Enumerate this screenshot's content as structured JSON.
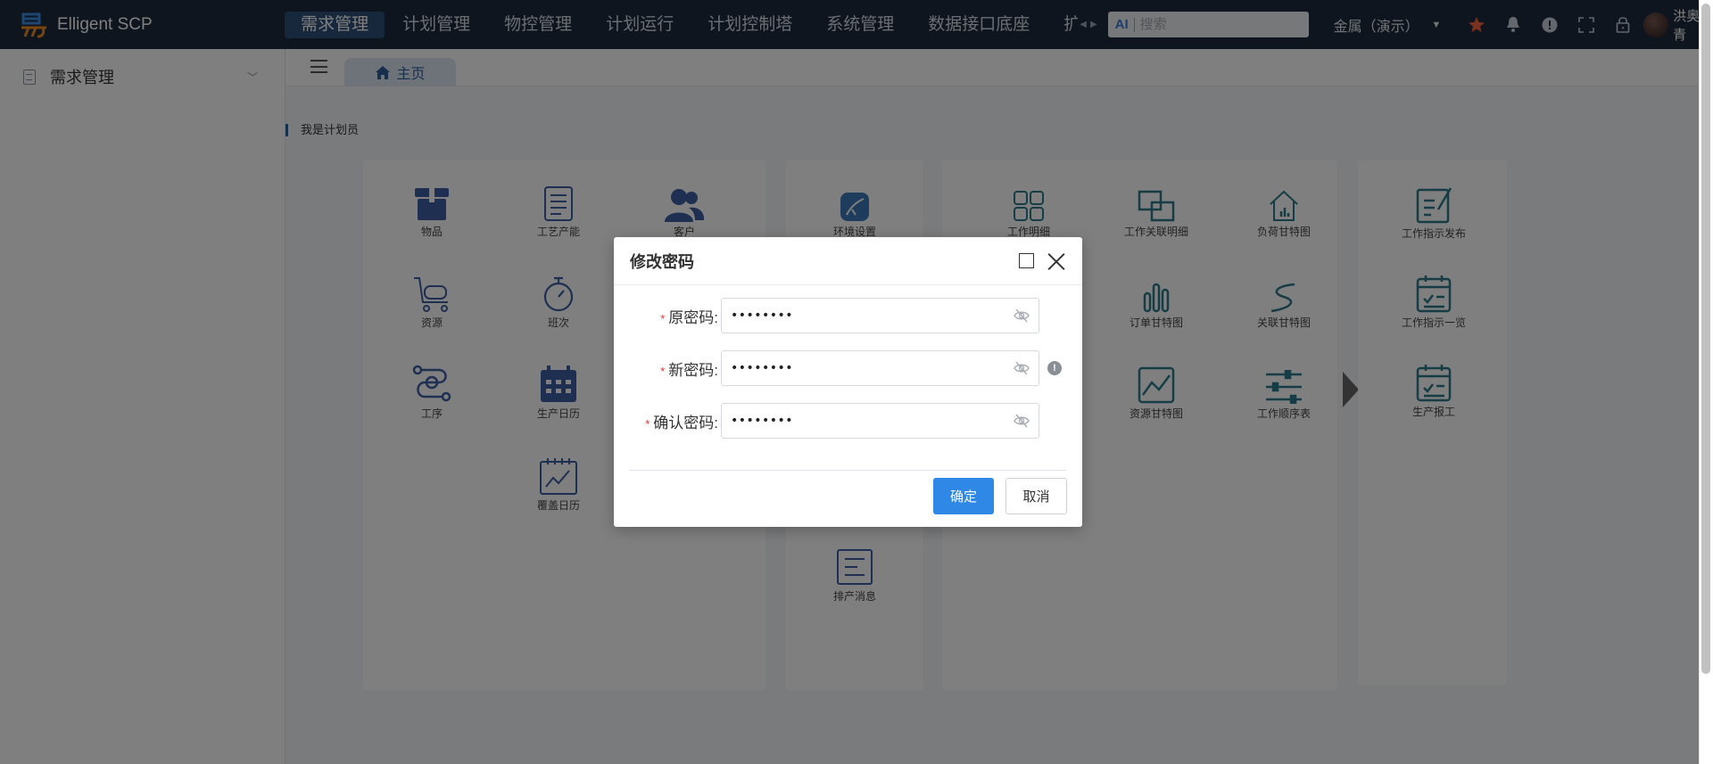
{
  "app": {
    "title": "Elligent SCP",
    "nav": [
      {
        "label": "需求管理",
        "active": true
      },
      {
        "label": "计划管理"
      },
      {
        "label": "物控管理"
      },
      {
        "label": "计划运行"
      },
      {
        "label": "计划控制塔"
      },
      {
        "label": "系统管理"
      },
      {
        "label": "数据接口底座"
      },
      {
        "label": "扩展"
      }
    ],
    "search": {
      "ai_label": "AI",
      "placeholder": "搜索"
    },
    "tenant": "金属（演示）",
    "user": "洪奥青",
    "icons": [
      "star-icon",
      "bell-icon",
      "alert-icon",
      "fullscreen-icon",
      "lock-icon"
    ]
  },
  "sidebar": {
    "items": [
      {
        "label": "需求管理"
      }
    ]
  },
  "tabs": [
    {
      "label": "主页"
    }
  ],
  "section_title": "我是计划员",
  "panels": {
    "panel1": [
      "物品",
      "工艺产能",
      "客户",
      "资源",
      "班次",
      "工序",
      "生产日历",
      "覆盖日历"
    ],
    "panel2": [
      "环境设置",
      "排产消息"
    ],
    "panel3": [
      "工作明细",
      "工作关联明细",
      "负荷甘特图",
      "订单甘特图",
      "关联甘特图",
      "资源甘特图",
      "工作顺序表"
    ],
    "panel4": [
      "工作指示发布",
      "工作指示一览",
      "生产报工"
    ]
  },
  "modal": {
    "title": "修改密码",
    "fields": [
      {
        "label": "原密码:",
        "value": "••••••••"
      },
      {
        "label": "新密码:",
        "value": "••••••••"
      },
      {
        "label": "确认密码:",
        "value": "••••••••"
      }
    ],
    "ok_label": "确定",
    "cancel_label": "取消"
  },
  "colors": {
    "accent": "#2f87e6",
    "nav_bg": "#1e2b3c",
    "icon_blue": "#3d5fa3",
    "icon_teal": "#2c7a8c"
  }
}
